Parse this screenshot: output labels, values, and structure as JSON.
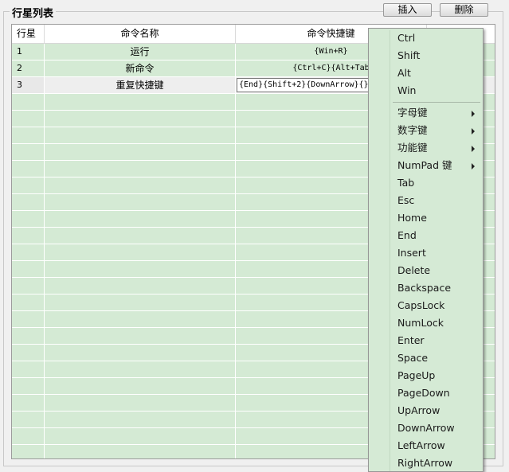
{
  "group": {
    "title": "行星列表"
  },
  "buttons": {
    "insert": "插入",
    "delete": "删除"
  },
  "table": {
    "headers": [
      "行星",
      "命令名称",
      "命令快捷键"
    ],
    "rows": [
      {
        "num": "1",
        "name": "运行",
        "shortcut": "{Win+R}"
      },
      {
        "num": "2",
        "name": "新命令",
        "shortcut": "{Ctrl+C}{Alt+Tab"
      },
      {
        "num": "3",
        "name": "重复快捷键",
        "shortcut": "{End}{Shift+2}{DownArrow}{}"
      }
    ]
  },
  "menu": {
    "items": [
      {
        "label": "Ctrl"
      },
      {
        "label": "Shift"
      },
      {
        "label": "Alt"
      },
      {
        "label": "Win"
      },
      {
        "label": "字母键",
        "submenu": true
      },
      {
        "label": "数字键",
        "submenu": true
      },
      {
        "label": "功能键",
        "submenu": true
      },
      {
        "label": "NumPad 键",
        "submenu": true
      },
      {
        "label": "Tab"
      },
      {
        "label": "Esc"
      },
      {
        "label": "Home"
      },
      {
        "label": "End"
      },
      {
        "label": "Insert"
      },
      {
        "label": "Delete"
      },
      {
        "label": "Backspace"
      },
      {
        "label": "CapsLock"
      },
      {
        "label": "NumLock"
      },
      {
        "label": "Enter"
      },
      {
        "label": "Space"
      },
      {
        "label": "PageUp"
      },
      {
        "label": "PageDown"
      },
      {
        "label": "UpArrow"
      },
      {
        "label": "DownArrow"
      },
      {
        "label": "LeftArrow"
      },
      {
        "label": "RightArrow"
      }
    ]
  },
  "colors": {
    "grid_fill": "#d4ead4",
    "menu_fill": "#d5ead5"
  }
}
